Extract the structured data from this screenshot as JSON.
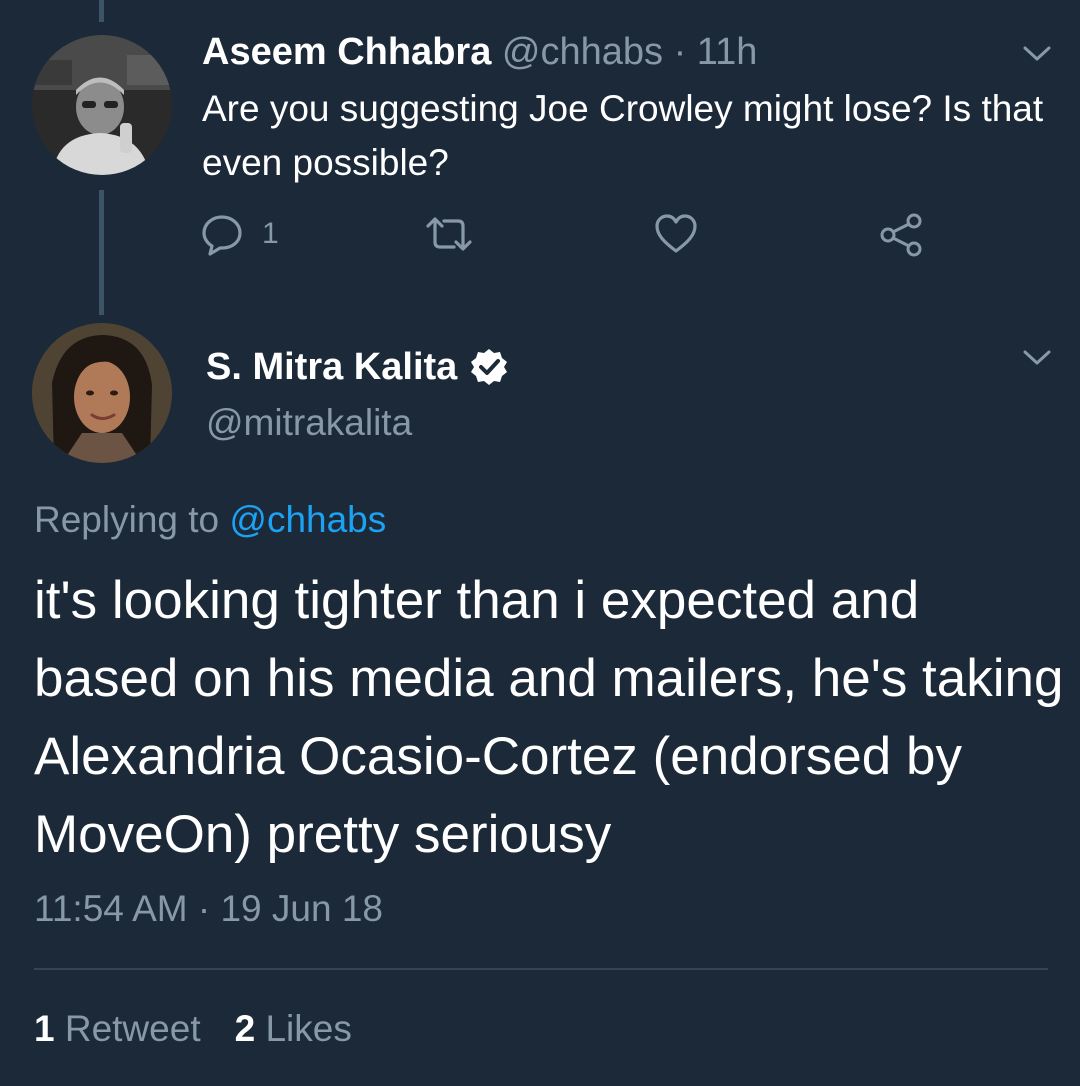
{
  "tweet1": {
    "name": "Aseem Chhabra",
    "handle": "@chhabs",
    "separator": "·",
    "time": "11h",
    "text": "Are you suggesting Joe Crowley might lose? Is that even possible?",
    "reply_count": "1",
    "icons": {
      "avatar": "avatar-photo",
      "menu": "chevron-down-icon",
      "reply": "reply-icon",
      "retweet": "retweet-icon",
      "like": "heart-icon",
      "share": "share-icon"
    }
  },
  "tweet2": {
    "name": "S. Mitra Kalita",
    "handle": "@mitrakalita",
    "verified_icon": "verified-badge-icon",
    "replying_prefix": "Replying to",
    "replying_mention": "@chhabs",
    "text": "it's looking tighter than i expected and based on his media and mailers, he's taking Alexandria Ocasio-Cortez (endorsed by MoveOn) pretty seriousy",
    "timestamp": "11:54 AM · 19 Jun 18",
    "retweet_count": "1",
    "retweet_label": "Retweet",
    "like_count": "2",
    "like_label": "Likes"
  },
  "colors": {
    "background": "#1c2938",
    "secondary_text": "#8899a6",
    "link": "#1da1f2",
    "thread_line": "#3d5466"
  }
}
